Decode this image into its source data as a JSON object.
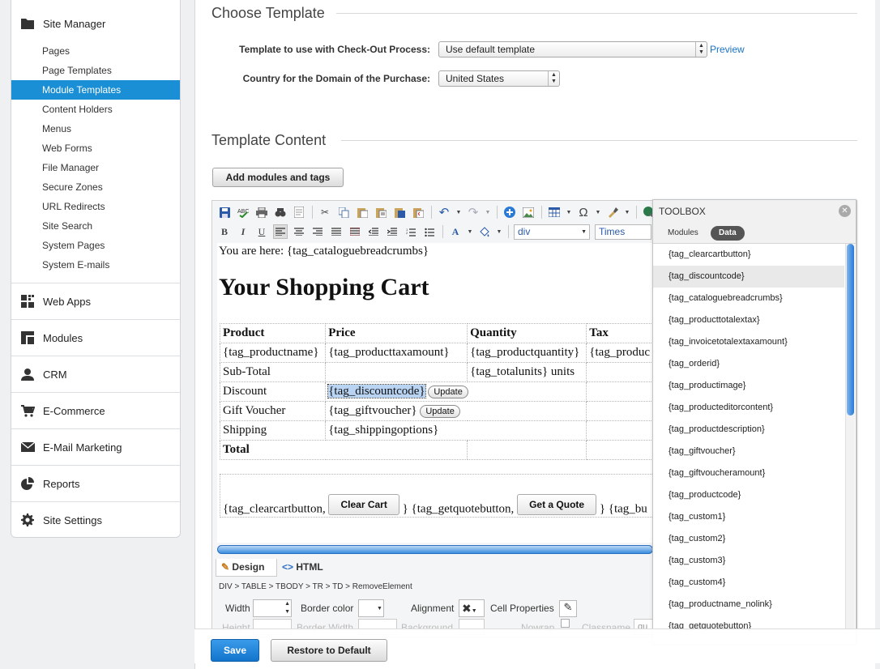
{
  "sidebar": {
    "site_manager": "Site Manager",
    "items": [
      "Pages",
      "Page Templates",
      "Module Templates",
      "Content Holders",
      "Menus",
      "Web Forms",
      "File Manager",
      "Secure Zones",
      "URL Redirects",
      "Site Search",
      "System Pages",
      "System E-mails"
    ],
    "active_index": 2,
    "sections": [
      "Web Apps",
      "Modules",
      "CRM",
      "E-Commerce",
      "E-Mail Marketing",
      "Reports",
      "Site Settings"
    ]
  },
  "choose": {
    "title": "Choose Template",
    "checkout_label": "Template to use with Check-Out Process:",
    "checkout_value": "Use default template",
    "preview": "Preview",
    "country_label": "Country for the Domain of the Purchase:",
    "country_value": "United States"
  },
  "template": {
    "title": "Template Content",
    "add_button": "Add modules and tags"
  },
  "editor": {
    "bold": "B",
    "italic": "I",
    "underline": "U",
    "block_format": "div",
    "font": "Times",
    "breadcrumb_text": "You are here: {tag_cataloguebreadcrumbs}",
    "heading": "Your Shopping Cart",
    "headers": [
      "Product",
      "Price",
      "Quantity",
      "Tax"
    ],
    "row1": [
      "{tag_productname}",
      "{tag_producttaxamount}",
      "{tag_productquantity}",
      "{tag_produc"
    ],
    "subtotal_label": "Sub-Total",
    "totalunits": "{tag_totalunits} units",
    "discount_label": "Discount",
    "discount_tag": "{tag_discountcode}",
    "update": "Update",
    "gift_label": "Gift Voucher",
    "gift_tag": "{tag_giftvoucher}",
    "shipping_label": "Shipping",
    "shipping_tag": "{tag_shippingoptions}",
    "total_label": "Total",
    "clear_pre": "{tag_clearcartbutton,",
    "clear_btn": "Clear Cart",
    "quote_pre": "} {tag_getquotebutton,",
    "quote_btn": "Get a Quote",
    "quote_post": "} {tag_bu",
    "tab_design": "Design",
    "tab_html": "HTML",
    "path": "DIV > TABLE > TBODY > TR > TD > RemoveElement",
    "width_label": "Width",
    "border_color_label": "Border color",
    "alignment_label": "Alignment",
    "cell_props_label": "Cell Properties",
    "height_label": "Height",
    "border_width_label": "Border Width",
    "background_label": "Background",
    "nowrap_label": "Nowrap",
    "classname_label": "Classname",
    "classname_value": "qu"
  },
  "toolbox": {
    "title": "TOOLBOX",
    "tab_modules": "Modules",
    "tab_data": "Data",
    "selected_index": 1,
    "tags": [
      "{tag_clearcartbutton}",
      "{tag_discountcode}",
      "{tag_cataloguebreadcrumbs}",
      "{tag_producttotalextax}",
      "{tag_invoicetotalextaxamount}",
      "{tag_orderid}",
      "{tag_productimage}",
      "{tag_producteditorcontent}",
      "{tag_productdescription}",
      "{tag_giftvoucher}",
      "{tag_giftvoucheramount}",
      "{tag_productcode}",
      "{tag_custom1}",
      "{tag_custom2}",
      "{tag_custom3}",
      "{tag_custom4}",
      "{tag_productname_nolink}",
      "{tag_getquotebutton}"
    ]
  },
  "footer": {
    "save": "Save",
    "restore": "Restore to Default"
  }
}
